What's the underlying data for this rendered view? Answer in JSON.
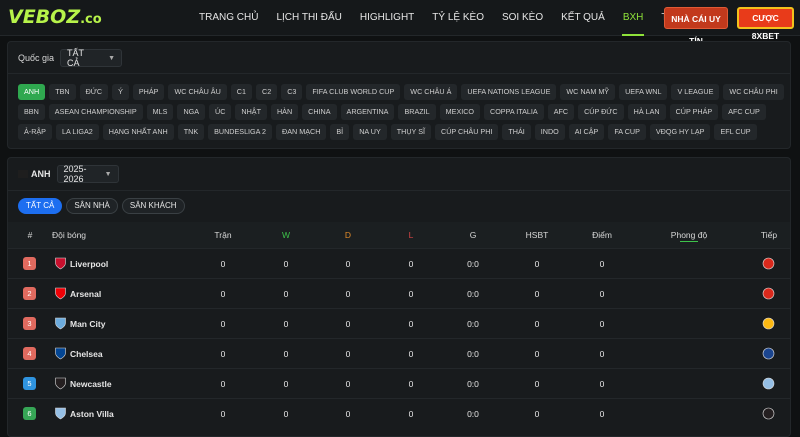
{
  "brand": {
    "logo": "VEBOZ",
    "logo_suffix": ".co"
  },
  "nav": [
    "TRANG CHỦ",
    "LỊCH THI ĐẤU",
    "HIGHLIGHT",
    "TỶ LỆ KÈO",
    "SOI KÈO",
    "KẾT QUẢ",
    "BXH",
    "TUYỂN DỤNG"
  ],
  "nav_active": "BXH",
  "header_buttons": {
    "nha_cai": "NHÀ CÁI UY TÍN",
    "cuoc": "CƯỢC 8XBET"
  },
  "country_filter": {
    "label": "Quốc gia",
    "value": "TẤT CẢ"
  },
  "leagues": [
    "ANH",
    "TBN",
    "ĐỨC",
    "Ý",
    "PHÁP",
    "WC CHÂU ÂU",
    "C1",
    "C2",
    "C3",
    "FIFA CLUB WORLD CUP",
    "WC CHÂU Á",
    "UEFA NATIONS LEAGUE",
    "WC NAM MỸ",
    "UEFA WNL",
    "V LEAGUE",
    "WC CHÂU PHI",
    "BBN",
    "ASEAN CHAMPIONSHIP",
    "MLS",
    "NGA",
    "ÚC",
    "NHẬT",
    "HÀN",
    "CHINA",
    "ARGENTINA",
    "BRAZIL",
    "MEXICO",
    "COPPA ITALIA",
    "AFC",
    "CÚP ĐỨC",
    "HÀ LAN",
    "CÚP PHÁP",
    "AFC CUP",
    "Ả-RẬP",
    "LA LIGA2",
    "HẠNG NHẤT ANH",
    "TNK",
    "BUNDESLIGA 2",
    "ĐAN MẠCH",
    "BỈ",
    "NA UY",
    "THỤY SĨ",
    "CÚP CHÂU PHI",
    "THÁI",
    "INDO",
    "AI CẬP",
    "FA CUP",
    "VĐQG HY LẠP",
    "EFL CUP"
  ],
  "league_active": "ANH",
  "standings": {
    "league": "ANH",
    "season": "2025-2026",
    "tabs": [
      "TẤT CẢ",
      "SÂN NHÀ",
      "SÂN KHÁCH"
    ],
    "tab_active": "TẤT CẢ",
    "columns": {
      "rank": "#",
      "team": "Đội bóng",
      "played": "Trận",
      "win": "W",
      "draw": "D",
      "loss": "L",
      "goals": "G",
      "gd": "HSBT",
      "points": "Điểm",
      "form": "Phong độ",
      "next": "Tiếp"
    },
    "rows": [
      {
        "rank": "1",
        "team": "Liverpool",
        "played": "0",
        "win": "0",
        "draw": "0",
        "loss": "0",
        "goals": "0:0",
        "gd": "0",
        "points": "0",
        "zone": "ucl",
        "crest": "#c8102e",
        "next_crest": "#da291c"
      },
      {
        "rank": "2",
        "team": "Arsenal",
        "played": "0",
        "win": "0",
        "draw": "0",
        "loss": "0",
        "goals": "0:0",
        "gd": "0",
        "points": "0",
        "zone": "ucl",
        "crest": "#ef0107",
        "next_crest": "#da291c"
      },
      {
        "rank": "3",
        "team": "Man City",
        "played": "0",
        "win": "0",
        "draw": "0",
        "loss": "0",
        "goals": "0:0",
        "gd": "0",
        "points": "0",
        "zone": "ucl",
        "crest": "#6cabdd",
        "next_crest": "#fdb913"
      },
      {
        "rank": "4",
        "team": "Chelsea",
        "played": "0",
        "win": "0",
        "draw": "0",
        "loss": "0",
        "goals": "0:0",
        "gd": "0",
        "points": "0",
        "zone": "ucl",
        "crest": "#034694",
        "next_crest": "#1b458f"
      },
      {
        "rank": "5",
        "team": "Newcastle",
        "played": "0",
        "win": "0",
        "draw": "0",
        "loss": "0",
        "goals": "0:0",
        "gd": "0",
        "points": "0",
        "zone": "uel",
        "crest": "#241f20",
        "next_crest": "#95bfe5"
      },
      {
        "rank": "6",
        "team": "Aston Villa",
        "played": "0",
        "win": "0",
        "draw": "0",
        "loss": "0",
        "goals": "0:0",
        "gd": "0",
        "points": "0",
        "zone": "uecl",
        "crest": "#95bfe5",
        "next_crest": "#241f20"
      }
    ]
  }
}
